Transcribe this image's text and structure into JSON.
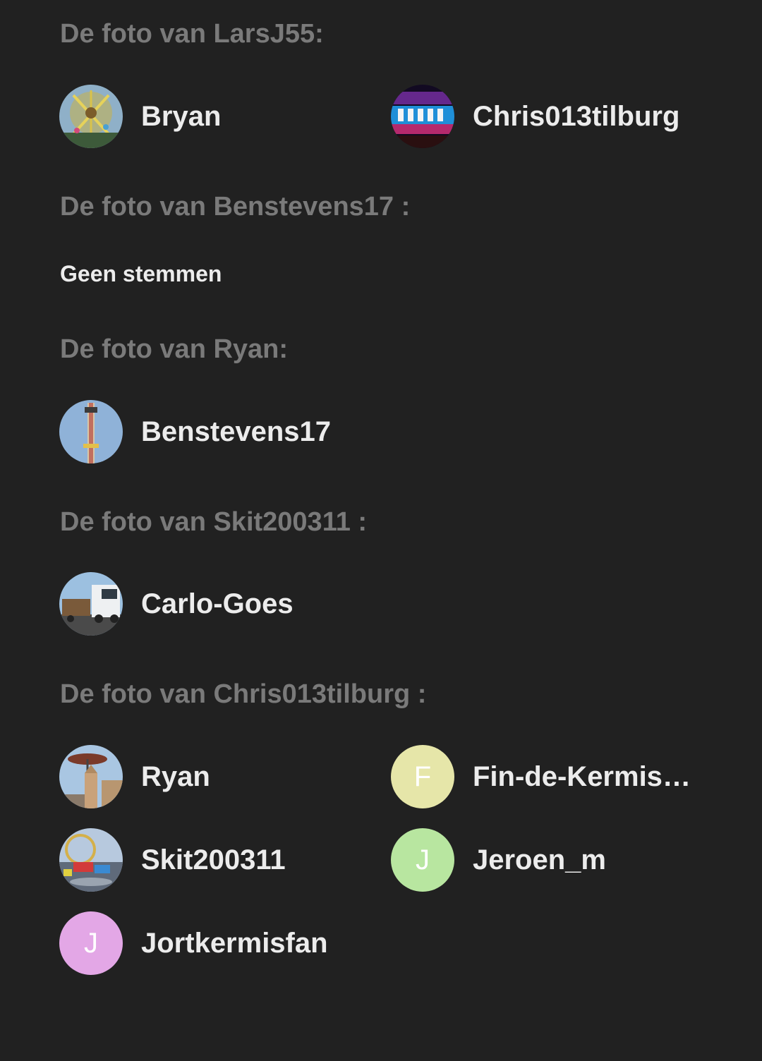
{
  "sections": [
    {
      "heading": "De foto van LarsJ55:",
      "voters": [
        {
          "name": "Bryan",
          "avatar": "photo-swing-ride"
        },
        {
          "name": "Chris013tilburg",
          "avatar": "photo-kermis-sign"
        }
      ]
    },
    {
      "heading": "De foto van Benstevens17 :",
      "empty_text": "Geen stemmen",
      "voters": []
    },
    {
      "heading": "De foto van Ryan:",
      "voters": [
        {
          "name": "Benstevens17",
          "avatar": "photo-drop-tower"
        }
      ]
    },
    {
      "heading": "De foto van Skit200311 :",
      "voters": [
        {
          "name": "Carlo-Goes",
          "avatar": "photo-truck"
        }
      ]
    },
    {
      "heading": "De foto van Chris013tilburg :",
      "voters": [
        {
          "name": "Ryan",
          "avatar": "photo-church-ride"
        },
        {
          "name": "Fin-de-Kermise…",
          "initial": "F",
          "color": "#e6e6a9"
        },
        {
          "name": "Skit200311",
          "avatar": "photo-fairground"
        },
        {
          "name": "Jeroen_m",
          "initial": "J",
          "color": "#b8e6a0"
        },
        {
          "name": "Jortkermisfan",
          "initial": "J",
          "color": "#e3a7e6"
        }
      ]
    }
  ]
}
